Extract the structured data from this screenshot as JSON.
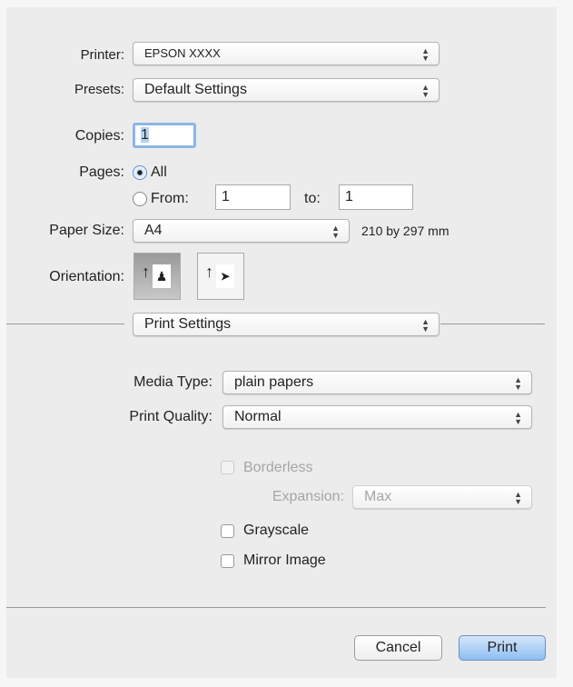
{
  "printer": {
    "label": "Printer:",
    "value": "EPSON XXXX"
  },
  "presets": {
    "label": "Presets:",
    "value": "Default Settings"
  },
  "copies": {
    "label": "Copies:",
    "value": "1"
  },
  "pages": {
    "label": "Pages:",
    "all_label": "All",
    "from_label": "From:",
    "from_value": "1",
    "to_label": "to:",
    "to_value": "1",
    "selected": "All"
  },
  "paper_size": {
    "label": "Paper Size:",
    "value": "A4",
    "dimensions": "210 by 297 mm"
  },
  "orientation": {
    "label": "Orientation:",
    "selected": "portrait"
  },
  "section": {
    "value": "Print Settings"
  },
  "media_type": {
    "label": "Media Type:",
    "value": "plain papers"
  },
  "print_quality": {
    "label": "Print Quality:",
    "value": "Normal"
  },
  "borderless": {
    "label": "Borderless",
    "checked": false,
    "disabled": true
  },
  "expansion": {
    "label": "Expansion:",
    "value": "Max",
    "disabled": true
  },
  "grayscale": {
    "label": "Grayscale",
    "checked": false
  },
  "mirror": {
    "label": "Mirror Image",
    "checked": false
  },
  "buttons": {
    "cancel": "Cancel",
    "print": "Print"
  }
}
